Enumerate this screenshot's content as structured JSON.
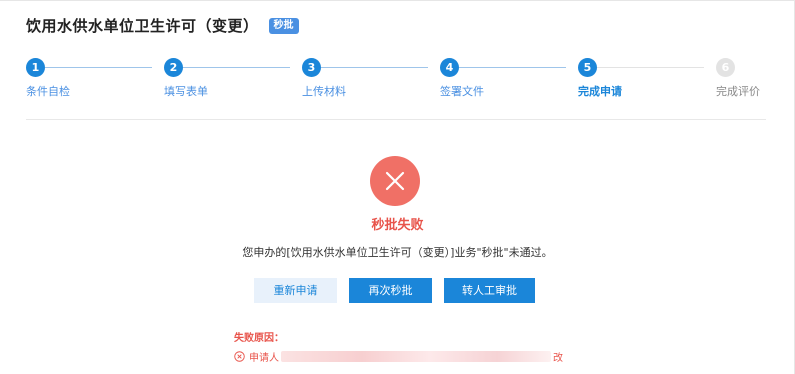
{
  "page": {
    "title": "饮用水供水单位卫生许可（变更）",
    "badge": "秒批"
  },
  "steps": [
    {
      "number": "1",
      "label": "条件自检",
      "state": "done"
    },
    {
      "number": "2",
      "label": "填写表单",
      "state": "done"
    },
    {
      "number": "3",
      "label": "上传材料",
      "state": "done"
    },
    {
      "number": "4",
      "label": "签署文件",
      "state": "done"
    },
    {
      "number": "5",
      "label": "完成申请",
      "state": "active"
    },
    {
      "number": "6",
      "label": "完成评价",
      "state": "future"
    }
  ],
  "result": {
    "title": "秒批失败",
    "message": "您申办的[饮用水供水单位卫生许可（变更）]业务\"秒批\"未通过。"
  },
  "actions": {
    "reapply": "重新申请",
    "retry": "再次秒批",
    "manual": "转人工审批"
  },
  "reason": {
    "title": "失败原因：",
    "item_start": "申请人",
    "item_end": "改"
  },
  "colors": {
    "primary": "#1b86d9",
    "error": "#e8544b",
    "fail_circle": "#f07066"
  },
  "icons": {
    "fail": "close-icon",
    "reason": "circle-x-icon"
  }
}
